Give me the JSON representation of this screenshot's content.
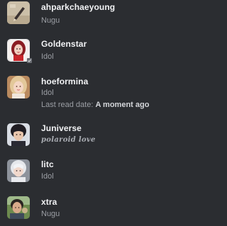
{
  "members": [
    {
      "name": "ahparkchaeyoung",
      "status": "Nugu",
      "avatar_icon": "avatar-pencil-drawing-icon"
    },
    {
      "name": "Goldenstar",
      "status": "Idol",
      "avatar_icon": "avatar-portrait-red-icon"
    },
    {
      "name": "hoeformina",
      "status": "Idol",
      "last_read_label": "Last read date:",
      "last_read_value": "A moment ago",
      "avatar_icon": "avatar-portrait-blonde-icon"
    },
    {
      "name": "Juniverse",
      "status": "polaroid love",
      "avatar_icon": "avatar-portrait-dark-icon"
    },
    {
      "name": "litc",
      "status": "Idol",
      "avatar_icon": "avatar-portrait-silver-icon"
    },
    {
      "name": "xtra",
      "status": "Nugu",
      "avatar_icon": "avatar-portrait-outdoor-icon"
    }
  ],
  "colors": {
    "background": "#2b2d31",
    "name": "#f2f3f5",
    "status": "#9b9ea4"
  }
}
